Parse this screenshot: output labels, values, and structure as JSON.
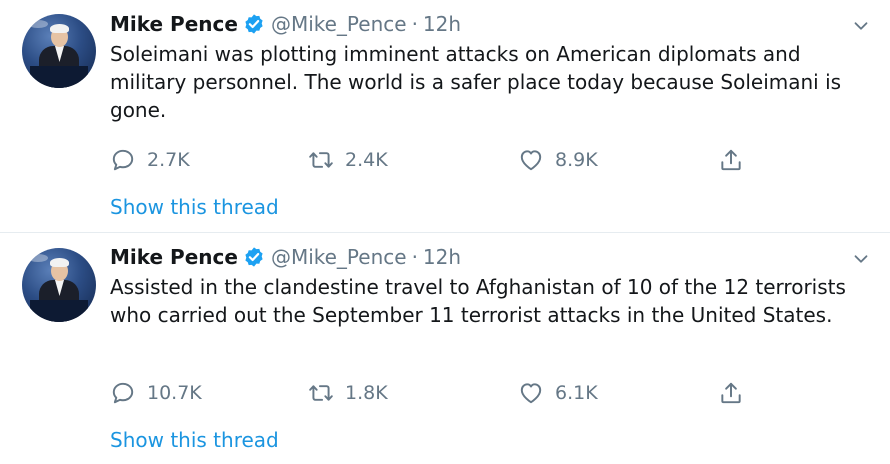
{
  "tweets": [
    {
      "author": "Mike Pence",
      "handle": "@Mike_Pence",
      "separator": "·",
      "time": "12h",
      "text": "Soleimani was plotting imminent attacks on American diplomats and military personnel. The world is a safer place today because Soleimani is gone.",
      "replies": "2.7K",
      "retweets": "2.4K",
      "likes": "8.9K",
      "show_thread": "Show this thread"
    },
    {
      "author": "Mike Pence",
      "handle": "@Mike_Pence",
      "separator": "·",
      "time": "12h",
      "text": "Assisted in the clandestine travel to Afghanistan of 10 of the 12 terrorists who carried out the September 11 terrorist attacks in the United States.",
      "replies": "10.7K",
      "retweets": "1.8K",
      "likes": "6.1K",
      "show_thread": "Show this thread"
    }
  ],
  "colors": {
    "verified": "#1da1f2",
    "link": "#1b95e0",
    "muted": "#657786",
    "text": "#14171a",
    "divider": "#e6ecf0"
  },
  "icons": [
    "verified-badge-icon",
    "chevron-down-icon",
    "reply-icon",
    "retweet-icon",
    "like-icon",
    "share-icon"
  ]
}
